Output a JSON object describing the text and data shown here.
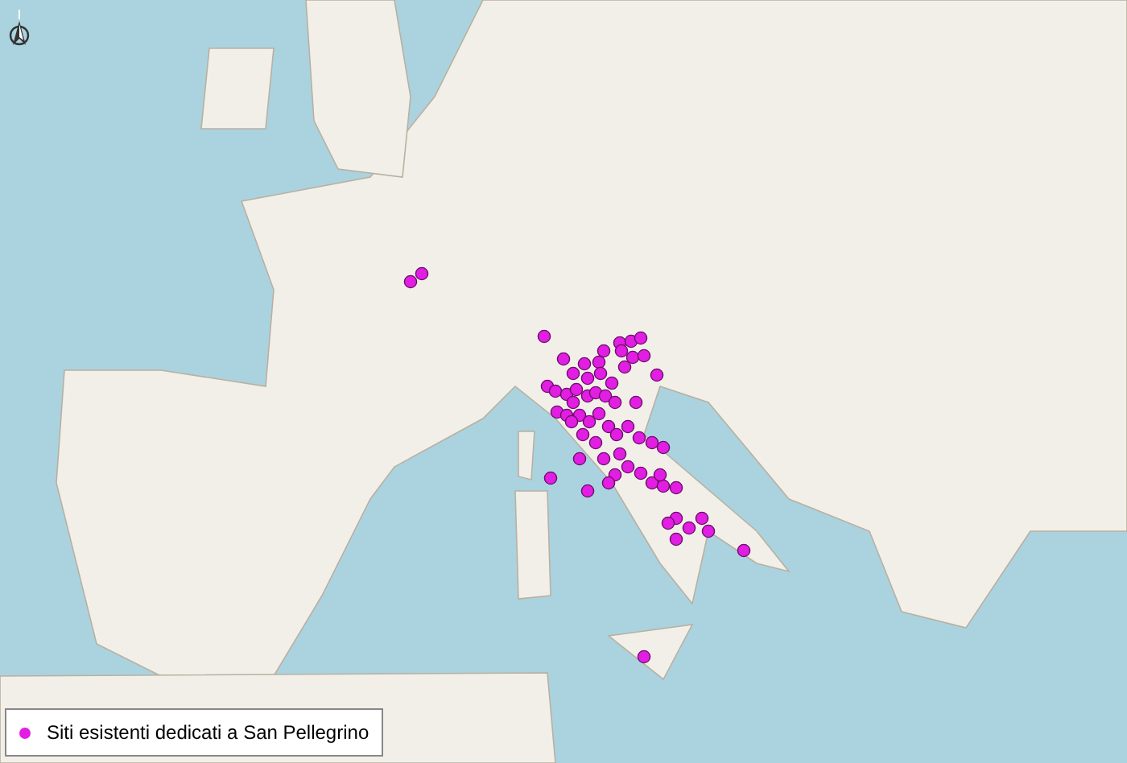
{
  "legend": {
    "items": [
      {
        "label": "Siti esistenti dedicati a San Pellegrino"
      }
    ]
  }
}
